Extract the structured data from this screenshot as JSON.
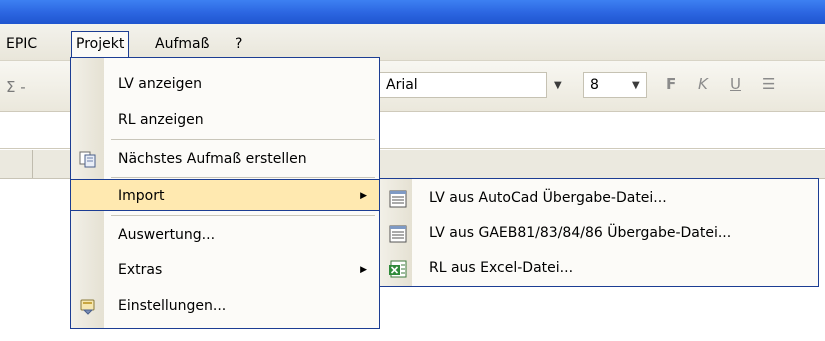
{
  "menubar": {
    "items": [
      {
        "label": "EPIC"
      },
      {
        "label": "Projekt"
      },
      {
        "label": "Aufmaß"
      },
      {
        "label": "?"
      }
    ]
  },
  "toolbar": {
    "font_name": "Arial",
    "font_size": "8"
  },
  "projekt_menu": {
    "items": [
      {
        "label": "LV anzeigen"
      },
      {
        "label": "RL anzeigen"
      },
      {
        "label": "Nächstes Aufmaß erstellen",
        "icon": "copy-document-icon"
      },
      {
        "label": "Import",
        "highlighted": true,
        "has_submenu": true
      },
      {
        "label": "Auswertung..."
      },
      {
        "label": "Extras",
        "has_submenu": true
      },
      {
        "label": "Einstellungen...",
        "icon": "settings-hand-icon"
      }
    ]
  },
  "import_submenu": {
    "items": [
      {
        "label": "LV aus AutoCad Übergabe-Datei...",
        "icon": "list-document-icon"
      },
      {
        "label": "LV aus GAEB81/83/84/86 Übergabe-Datei...",
        "icon": "list-document-icon"
      },
      {
        "label": "RL aus Excel-Datei...",
        "icon": "excel-icon"
      }
    ]
  },
  "colors": {
    "highlight": "#ffe9b0",
    "menu_border": "#1c3d93",
    "title_bar": "#2b65e0"
  }
}
